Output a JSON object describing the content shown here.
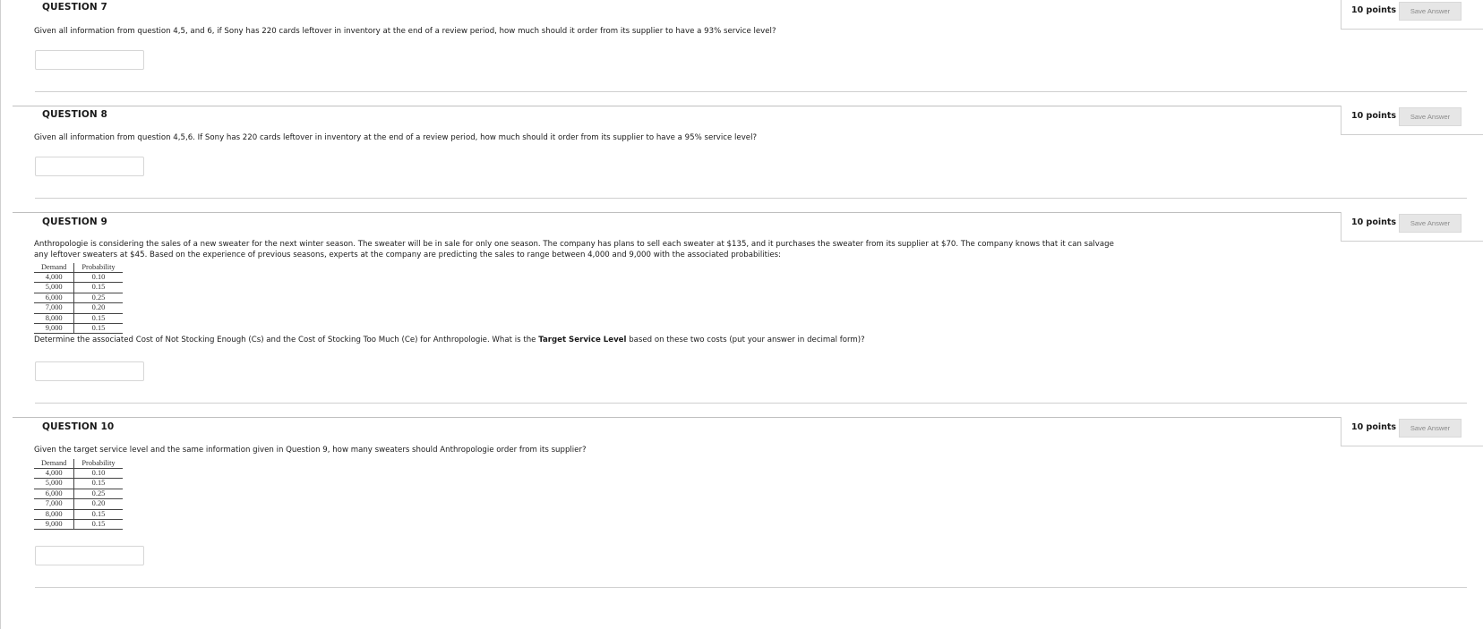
{
  "questions": [
    {
      "title": "QUESTION 7",
      "points": "10 points",
      "save_label": "Save Answer",
      "text": "Given all information from question 4,5, and 6, if Sony has 220 cards leftover in inventory at the end of a review period, how much should it order from its supplier to have a 93% service level?"
    },
    {
      "title": "QUESTION 8",
      "points": "10 points",
      "save_label": "Save Answer",
      "text": "Given all information from question 4,5,6. If Sony has 220 cards leftover in inventory at the end of a review period, how much should it order from its supplier to have a 95% service level?"
    },
    {
      "title": "QUESTION 9",
      "points": "10 points",
      "save_label": "Save Answer",
      "intro_line1": "Anthropologie is considering the sales of a new sweater for the next winter season. The sweater will be in sale for only one season. The company has plans to sell each sweater at $135, and it purchases the sweater from its supplier at $70. The company knows that it can salvage",
      "intro_line2": "any leftover sweaters at $45. Based on the experience of previous seasons, experts at the company are predicting the sales to range between 4,000 and 9,000 with the associated probabilities:",
      "prompt_before": "Determine the associated Cost of Not Stocking Enough (Cs) and the Cost of Stocking Too Much (Ce) for Anthropologie. What is the ",
      "prompt_bold": "Target Service Level",
      "prompt_after": " based on these two costs (put your answer in decimal form)?"
    },
    {
      "title": "QUESTION 10",
      "points": "10 points",
      "save_label": "Save Answer",
      "text": "Given the target service level and the same information given in Question 9, how many sweaters should Anthropologie order from its supplier?"
    }
  ],
  "demand_table": {
    "headers": [
      "Demand",
      "Probability"
    ],
    "rows": [
      [
        "4,000",
        "0.10"
      ],
      [
        "5,000",
        "0.15"
      ],
      [
        "6,000",
        "0.25"
      ],
      [
        "7,000",
        "0.20"
      ],
      [
        "8,000",
        "0.15"
      ],
      [
        "9,000",
        "0.15"
      ]
    ]
  }
}
